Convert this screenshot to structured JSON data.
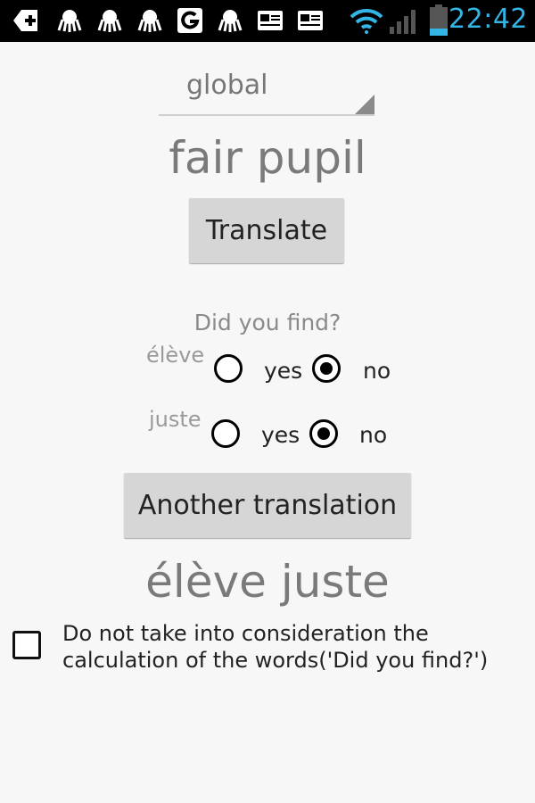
{
  "status_bar": {
    "time": "22:42",
    "icons": [
      "add-icon",
      "octopus-icon",
      "octopus-icon",
      "octopus-icon",
      "g-icon",
      "octopus-icon",
      "card-icon",
      "card-icon",
      "wifi-icon",
      "signal-icon",
      "battery-icon"
    ]
  },
  "spinner": {
    "selected": "global"
  },
  "source_phrase": "fair pupil",
  "translate_button": "Translate",
  "feedback": {
    "question": "Did you find?",
    "words": [
      {
        "word": "élève",
        "yes_label": "yes",
        "no_label": "no",
        "selected": "no"
      },
      {
        "word": "juste",
        "yes_label": "yes",
        "no_label": "no",
        "selected": "no"
      }
    ]
  },
  "another_translation_button": "Another translation",
  "translation_result": "élève juste",
  "exclude_checkbox": {
    "label": "Do not take into consideration the calculation of the words('Did you find?')",
    "checked": false
  },
  "colors": {
    "accent": "#33b5e5",
    "status_bar_bg": "#000000",
    "button_bg": "#d6d6d6",
    "page_bg": "#f7f7f7"
  }
}
